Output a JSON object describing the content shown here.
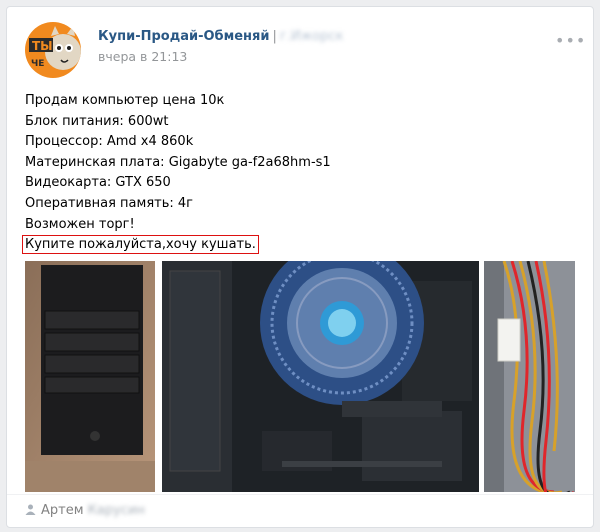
{
  "post": {
    "group_name": "Купи-Продай-Обменяй",
    "separator": "|",
    "group_suffix_blurred": "г.Ижорск",
    "date": "вчера в 21:13",
    "more_icon": "•••",
    "lines": [
      "Продам компьютер цена 10к",
      "Блок питания: 600wt",
      "Процессор: Amd x4 860k",
      "Материнская плата: Gigabyte ga-f2a68hm-s1",
      "Видеокарта: GTX 650",
      "Оперативная память: 4г",
      "Возможен торг!"
    ],
    "highlighted_line": "Купите пожалуйста,хочу кушать.",
    "author": {
      "icon": "user-icon",
      "first_name": "Артем",
      "last_name_blurred": "Карусин"
    },
    "avatar": {
      "logo_text_1": "ТЫ",
      "logo_text_2": "ЧЕ",
      "colors": {
        "orange": "#f18a1f",
        "dark": "#2b2b2b"
      }
    },
    "photos": [
      "pc-case-photo",
      "cpu-cooler-photo",
      "psu-cables-photo"
    ]
  },
  "colors": {
    "link": "#2a5885",
    "meta": "#939699",
    "highlight_border": "#dd1111"
  }
}
